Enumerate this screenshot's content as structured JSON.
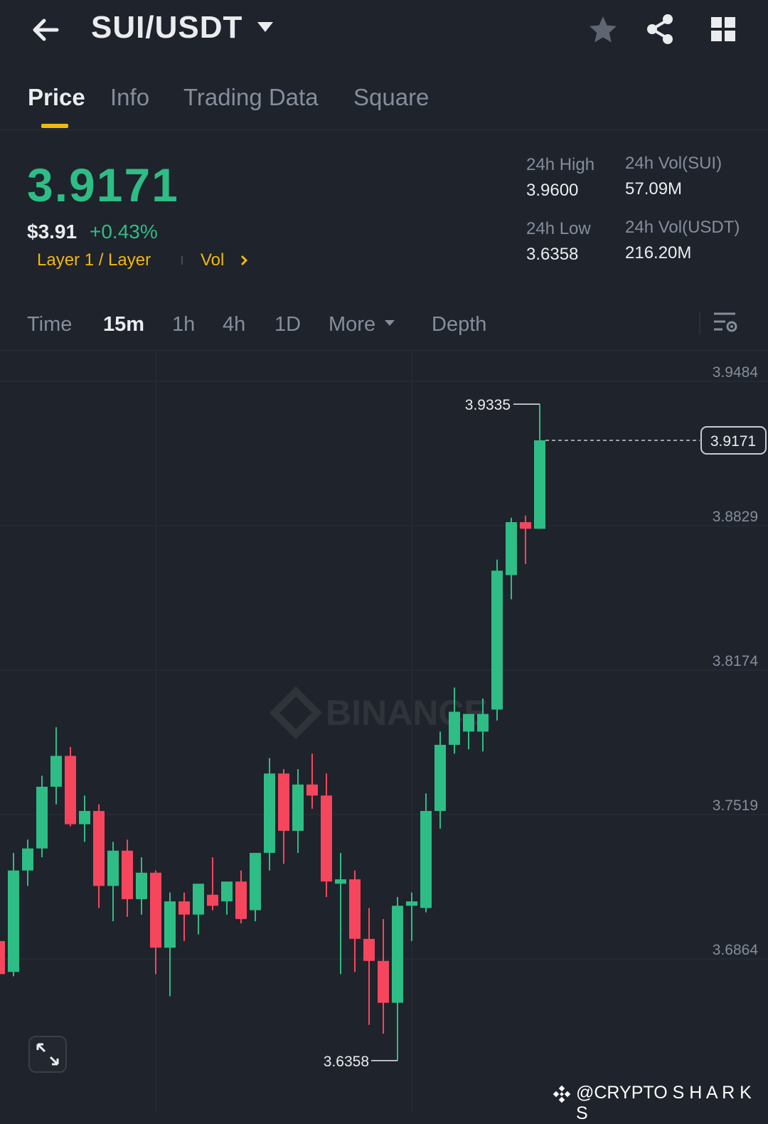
{
  "header": {
    "pair": "SUI/USDT",
    "icons": [
      "back-arrow-icon",
      "chevron-down-icon",
      "star-icon",
      "share-icon",
      "grid-icon"
    ]
  },
  "tabs": [
    {
      "label": "Price",
      "active": true
    },
    {
      "label": "Info",
      "active": false
    },
    {
      "label": "Trading Data",
      "active": false
    },
    {
      "label": "Square",
      "active": false
    }
  ],
  "ticker": {
    "last_price": "3.9171",
    "usd_price": "$3.91",
    "change": "+0.43%",
    "tag": "Layer 1 / Layer",
    "vol_link": "Vol"
  },
  "stats": {
    "high_label": "24h High",
    "high_value": "3.9600",
    "low_label": "24h Low",
    "low_value": "3.6358",
    "vol_base_label": "24h Vol(SUI)",
    "vol_base_value": "57.09M",
    "vol_quote_label": "24h Vol(USDT)",
    "vol_quote_value": "216.20M"
  },
  "timeframes": [
    {
      "label": "Time",
      "active": false
    },
    {
      "label": "15m",
      "active": true
    },
    {
      "label": "1h",
      "active": false
    },
    {
      "label": "4h",
      "active": false
    },
    {
      "label": "1D",
      "active": false
    },
    {
      "label": "More",
      "active": false
    },
    {
      "label": "Depth",
      "active": false
    }
  ],
  "colors": {
    "up": "#2ebd85",
    "down": "#f6465d",
    "accent": "#f0b90b",
    "background": "#1f232b"
  },
  "chart_data": {
    "type": "candlestick",
    "interval": "15m",
    "y_ticks": [
      3.9484,
      3.8829,
      3.8174,
      3.7519,
      3.6864
    ],
    "y_tick_labels": [
      "3.9484",
      "3.8829",
      "3.8174",
      "3.7519",
      "3.6864"
    ],
    "last_price_label": "3.9171",
    "max_label": "3.9335",
    "min_label": "3.6358",
    "watermark": "BINANCE",
    "candles": [
      {
        "o": 3.69,
        "h": 3.7,
        "l": 3.665,
        "c": 3.675
      },
      {
        "o": 3.676,
        "h": 3.73,
        "l": 3.674,
        "c": 3.722
      },
      {
        "o": 3.722,
        "h": 3.736,
        "l": 3.715,
        "c": 3.732
      },
      {
        "o": 3.732,
        "h": 3.765,
        "l": 3.728,
        "c": 3.76
      },
      {
        "o": 3.76,
        "h": 3.787,
        "l": 3.752,
        "c": 3.774
      },
      {
        "o": 3.774,
        "h": 3.778,
        "l": 3.742,
        "c": 3.743
      },
      {
        "o": 3.743,
        "h": 3.756,
        "l": 3.735,
        "c": 3.749
      },
      {
        "o": 3.749,
        "h": 3.752,
        "l": 3.705,
        "c": 3.715
      },
      {
        "o": 3.715,
        "h": 3.735,
        "l": 3.699,
        "c": 3.731
      },
      {
        "o": 3.731,
        "h": 3.736,
        "l": 3.701,
        "c": 3.709
      },
      {
        "o": 3.709,
        "h": 3.728,
        "l": 3.702,
        "c": 3.721
      },
      {
        "o": 3.721,
        "h": 3.722,
        "l": 3.675,
        "c": 3.687
      },
      {
        "o": 3.687,
        "h": 3.712,
        "l": 3.665,
        "c": 3.708
      },
      {
        "o": 3.708,
        "h": 3.712,
        "l": 3.69,
        "c": 3.702
      },
      {
        "o": 3.702,
        "h": 3.712,
        "l": 3.693,
        "c": 3.716
      },
      {
        "o": 3.711,
        "h": 3.728,
        "l": 3.704,
        "c": 3.706
      },
      {
        "o": 3.708,
        "h": 3.716,
        "l": 3.702,
        "c": 3.717
      },
      {
        "o": 3.717,
        "h": 3.722,
        "l": 3.698,
        "c": 3.7
      },
      {
        "o": 3.704,
        "h": 3.729,
        "l": 3.699,
        "c": 3.73
      },
      {
        "o": 3.73,
        "h": 3.773,
        "l": 3.722,
        "c": 3.766
      },
      {
        "o": 3.766,
        "h": 3.768,
        "l": 3.725,
        "c": 3.74
      },
      {
        "o": 3.74,
        "h": 3.768,
        "l": 3.73,
        "c": 3.761
      },
      {
        "o": 3.761,
        "h": 3.775,
        "l": 3.75,
        "c": 3.756
      },
      {
        "o": 3.756,
        "h": 3.766,
        "l": 3.71,
        "c": 3.717
      },
      {
        "o": 3.716,
        "h": 3.73,
        "l": 3.675,
        "c": 3.718
      },
      {
        "o": 3.718,
        "h": 3.722,
        "l": 3.676,
        "c": 3.691
      },
      {
        "o": 3.691,
        "h": 3.705,
        "l": 3.652,
        "c": 3.681
      },
      {
        "o": 3.681,
        "h": 3.7,
        "l": 3.648,
        "c": 3.662
      },
      {
        "o": 3.662,
        "h": 3.71,
        "l": 3.6358,
        "c": 3.706
      },
      {
        "o": 3.706,
        "h": 3.712,
        "l": 3.69,
        "c": 3.708
      },
      {
        "o": 3.705,
        "h": 3.757,
        "l": 3.703,
        "c": 3.749
      },
      {
        "o": 3.749,
        "h": 3.785,
        "l": 3.741,
        "c": 3.779
      },
      {
        "o": 3.779,
        "h": 3.805,
        "l": 3.775,
        "c": 3.794
      },
      {
        "o": 3.785,
        "h": 3.792,
        "l": 3.777,
        "c": 3.793
      },
      {
        "o": 3.785,
        "h": 3.8,
        "l": 3.776,
        "c": 3.793
      },
      {
        "o": 3.795,
        "h": 3.863,
        "l": 3.79,
        "c": 3.858
      },
      {
        "o": 3.856,
        "h": 3.882,
        "l": 3.845,
        "c": 3.88
      },
      {
        "o": 3.88,
        "h": 3.883,
        "l": 3.861,
        "c": 3.877
      },
      {
        "o": 3.877,
        "h": 3.9335,
        "l": 3.877,
        "c": 3.9171
      }
    ]
  },
  "watermark_credit": "@CRYPTO S H A R K S"
}
